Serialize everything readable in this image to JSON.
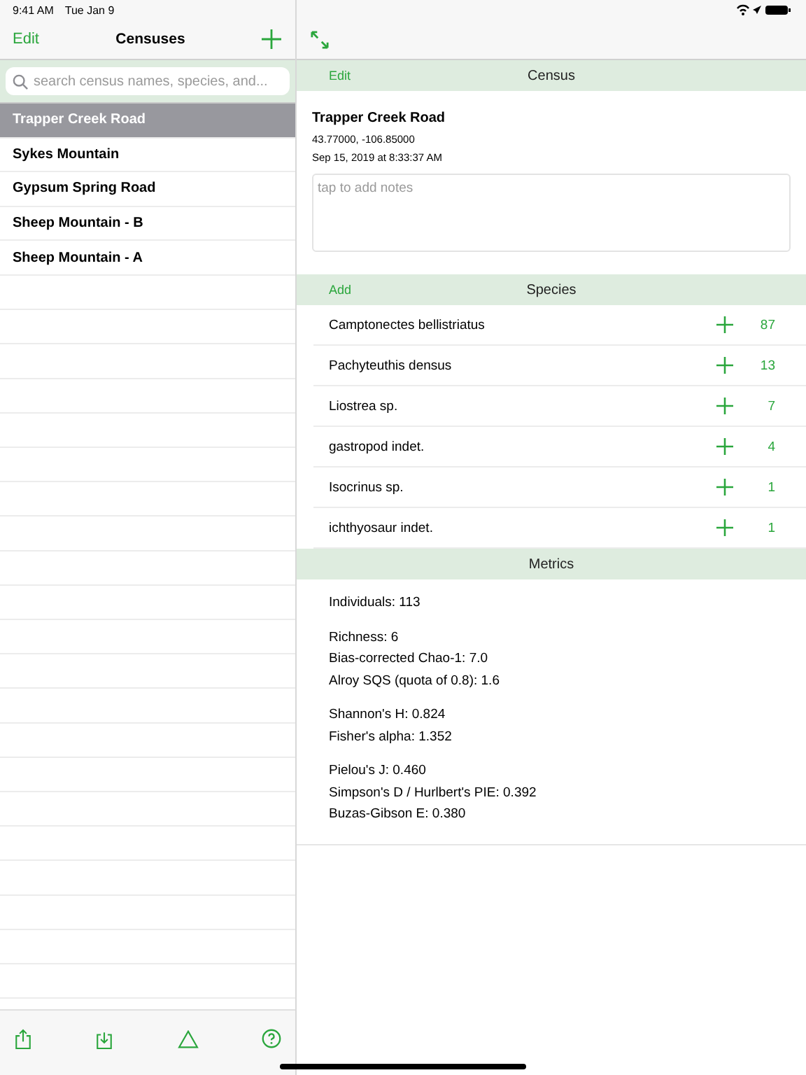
{
  "status_bar": {
    "time": "9:41 AM",
    "date": "Tue Jan 9"
  },
  "sidebar": {
    "edit": "Edit",
    "title": "Censuses",
    "search": {
      "placeholder": "search census names, species, and..."
    },
    "items": [
      {
        "name": "Trapper Creek Road",
        "selected": true
      },
      {
        "name": "Sykes Mountain",
        "selected": false
      },
      {
        "name": "Gypsum Spring Road",
        "selected": false
      },
      {
        "name": "Sheep Mountain - B",
        "selected": false
      },
      {
        "name": "Sheep Mountain - A",
        "selected": false
      }
    ]
  },
  "census": {
    "edit": "Edit",
    "title": "Census",
    "name": "Trapper Creek Road",
    "coordinates": "43.77000, -106.85000",
    "timestamp": "Sep 15, 2019 at 8:33:37 AM",
    "notes": {
      "placeholder": "tap to add notes"
    }
  },
  "species": {
    "add": "Add",
    "title": "Species",
    "rows": [
      {
        "name": "Camptonectes bellistriatus",
        "count": "87"
      },
      {
        "name": "Pachyteuthis densus",
        "count": "13"
      },
      {
        "name": "Liostrea sp.",
        "count": "7"
      },
      {
        "name": "gastropod indet.",
        "count": "4"
      },
      {
        "name": "Isocrinus sp.",
        "count": "1"
      },
      {
        "name": "ichthyosaur indet.",
        "count": "1"
      }
    ]
  },
  "metrics": {
    "title": "Metrics",
    "groups": [
      [
        "Individuals: 113"
      ],
      [
        "Richness: 6",
        "Bias-corrected Chao-1: 7.0",
        "Alroy SQS (quota of 0.8): 1.6"
      ],
      [
        "Shannon's H: 0.824",
        "Fisher's alpha: 1.352"
      ],
      [
        "Pielou's J: 0.460",
        "Simpson's D / Hurlbert's PIE: 0.392",
        "Buzas-Gibson E: 0.380"
      ]
    ]
  }
}
